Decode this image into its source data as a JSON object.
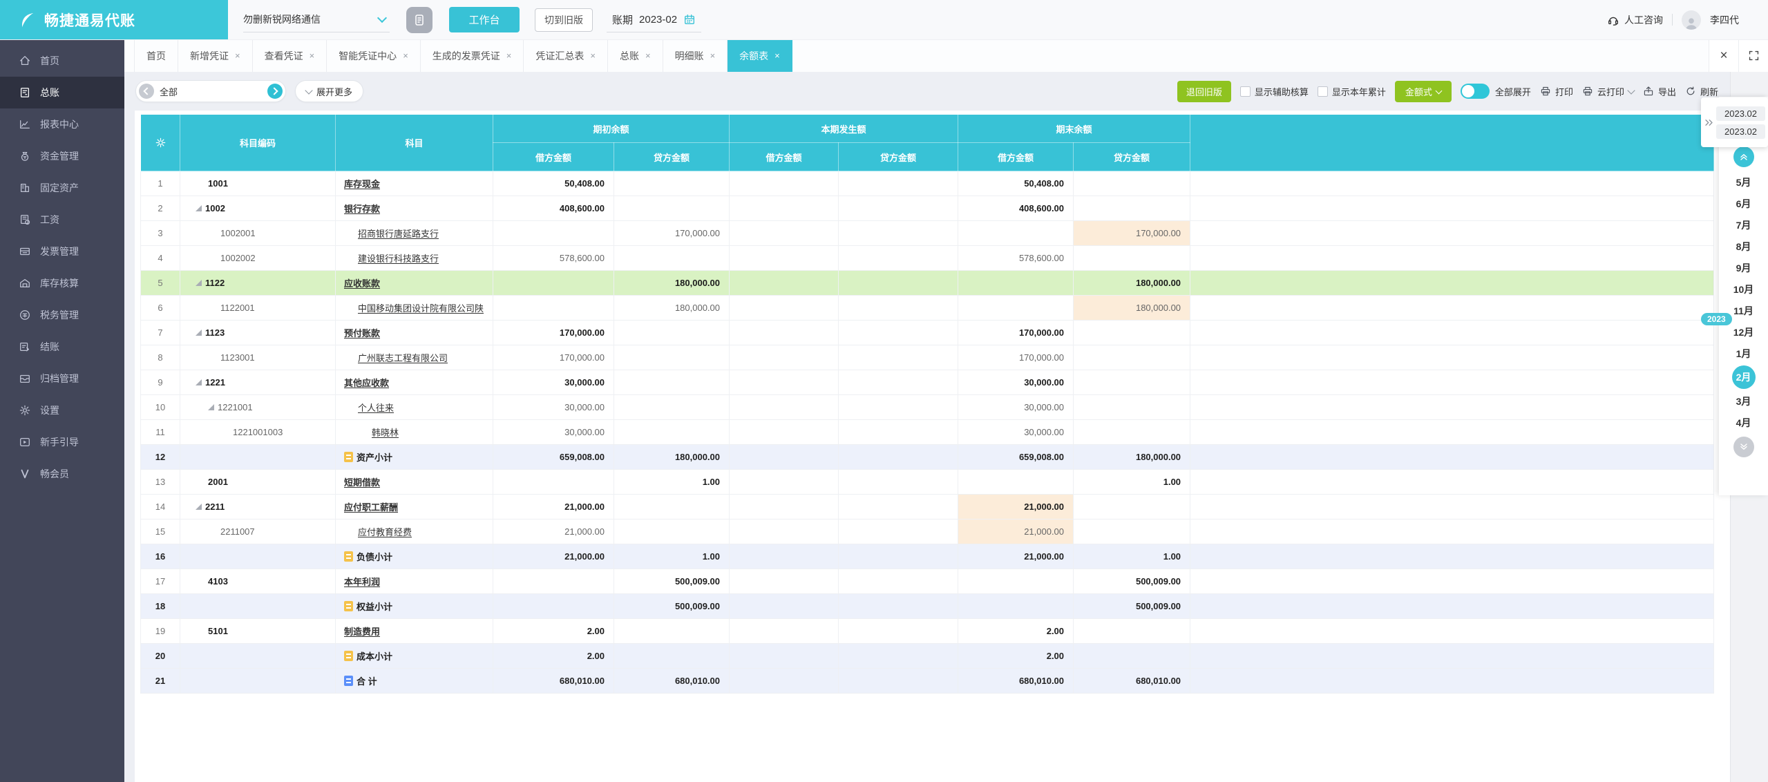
{
  "topbar": {
    "logo": "畅捷通易代账",
    "company": "勿删新锐网络通信",
    "workbench": "工作台",
    "switch_old": "切到旧版",
    "period_label": "账期",
    "period_value": "2023-02",
    "support": "人工咨询",
    "username": "李四代"
  },
  "sidebar": {
    "items": [
      {
        "label": "首页",
        "icon": "home-icon",
        "active": false
      },
      {
        "label": "总账",
        "icon": "ledger-icon",
        "active": true
      },
      {
        "label": "报表中心",
        "icon": "report-icon",
        "active": false
      },
      {
        "label": "资金管理",
        "icon": "fund-icon",
        "active": false
      },
      {
        "label": "固定资产",
        "icon": "asset-icon",
        "active": false
      },
      {
        "label": "工资",
        "icon": "salary-icon",
        "active": false
      },
      {
        "label": "发票管理",
        "icon": "invoice-icon",
        "active": false
      },
      {
        "label": "库存核算",
        "icon": "inventory-icon",
        "active": false
      },
      {
        "label": "税务管理",
        "icon": "tax-icon",
        "active": false
      },
      {
        "label": "结账",
        "icon": "closing-icon",
        "active": false
      },
      {
        "label": "归档管理",
        "icon": "archive-icon",
        "active": false
      },
      {
        "label": "设置",
        "icon": "settings-icon",
        "active": false
      },
      {
        "label": "新手引导",
        "icon": "guide-icon",
        "active": false
      },
      {
        "label": "畅会员",
        "icon": "member-icon",
        "active": false
      }
    ]
  },
  "tabbar": {
    "tabs": [
      {
        "label": "首页",
        "closable": false,
        "active": false
      },
      {
        "label": "新增凭证",
        "closable": true,
        "active": false
      },
      {
        "label": "查看凭证",
        "closable": true,
        "active": false
      },
      {
        "label": "智能凭证中心",
        "closable": true,
        "active": false
      },
      {
        "label": "生成的发票凭证",
        "closable": true,
        "active": false
      },
      {
        "label": "凭证汇总表",
        "closable": true,
        "active": false
      },
      {
        "label": "总账",
        "closable": true,
        "active": false
      },
      {
        "label": "明细账",
        "closable": true,
        "active": false
      },
      {
        "label": "余额表",
        "closable": true,
        "active": true
      }
    ]
  },
  "toolbar": {
    "filter_all": "全部",
    "expand_more": "展开更多",
    "back_old": "退回旧版",
    "show_aux": "显示辅助核算",
    "show_ytd": "显示本年累计",
    "amount_style": "金额式",
    "expand_all": "全部展开",
    "print": "打印",
    "cloud_print": "云打印",
    "export": "导出",
    "refresh": "刷新"
  },
  "table": {
    "group_headers": {
      "code": "科目编码",
      "subject": "科目",
      "opening": "期初余额",
      "current": "本期发生额",
      "ending": "期末余额"
    },
    "sub_headers": {
      "debit": "借方金额",
      "credit": "贷方金额"
    },
    "rows": [
      {
        "num": 1,
        "code": "1001",
        "level": 0,
        "expand": false,
        "bold": true,
        "type": "account",
        "subject": "库存现金",
        "ob_d": "50,408.00",
        "ob_c": "",
        "cp_d": "",
        "cp_c": "",
        "eb_d": "50,408.00",
        "eb_c": "",
        "row_bg": "",
        "icon": "",
        "peach": []
      },
      {
        "num": 2,
        "code": "1002",
        "level": 0,
        "expand": true,
        "bold": true,
        "type": "account",
        "subject": "银行存款",
        "ob_d": "408,600.00",
        "ob_c": "",
        "cp_d": "",
        "cp_c": "",
        "eb_d": "408,600.00",
        "eb_c": "",
        "row_bg": "",
        "icon": "",
        "peach": []
      },
      {
        "num": 3,
        "code": "1002001",
        "level": 1,
        "expand": false,
        "bold": false,
        "type": "account",
        "subject": "招商银行唐延路支行",
        "ob_d": "",
        "ob_c": "170,000.00",
        "cp_d": "",
        "cp_c": "",
        "eb_d": "",
        "eb_c": "170,000.00",
        "row_bg": "",
        "icon": "",
        "peach": [
          "eb_c"
        ]
      },
      {
        "num": 4,
        "code": "1002002",
        "level": 1,
        "expand": false,
        "bold": false,
        "type": "account",
        "subject": "建设银行科技路支行",
        "ob_d": "578,600.00",
        "ob_c": "",
        "cp_d": "",
        "cp_c": "",
        "eb_d": "578,600.00",
        "eb_c": "",
        "row_bg": "",
        "icon": "",
        "peach": []
      },
      {
        "num": 5,
        "code": "1122",
        "level": 0,
        "expand": true,
        "bold": true,
        "type": "account",
        "subject": "应收账款",
        "ob_d": "",
        "ob_c": "180,000.00",
        "cp_d": "",
        "cp_c": "",
        "eb_d": "",
        "eb_c": "180,000.00",
        "row_bg": "green",
        "icon": "",
        "peach": [
          "eb_c"
        ]
      },
      {
        "num": 6,
        "code": "1122001",
        "level": 1,
        "expand": false,
        "bold": false,
        "type": "account",
        "subject": "中国移动集团设计院有限公司陕",
        "ob_d": "",
        "ob_c": "180,000.00",
        "cp_d": "",
        "cp_c": "",
        "eb_d": "",
        "eb_c": "180,000.00",
        "row_bg": "",
        "icon": "",
        "peach": [
          "eb_c"
        ]
      },
      {
        "num": 7,
        "code": "1123",
        "level": 0,
        "expand": true,
        "bold": true,
        "type": "account",
        "subject": "预付账款",
        "ob_d": "170,000.00",
        "ob_c": "",
        "cp_d": "",
        "cp_c": "",
        "eb_d": "170,000.00",
        "eb_c": "",
        "row_bg": "",
        "icon": "",
        "peach": []
      },
      {
        "num": 8,
        "code": "1123001",
        "level": 1,
        "expand": false,
        "bold": false,
        "type": "account",
        "subject": "广州联志工程有限公司",
        "ob_d": "170,000.00",
        "ob_c": "",
        "cp_d": "",
        "cp_c": "",
        "eb_d": "170,000.00",
        "eb_c": "",
        "row_bg": "",
        "icon": "",
        "peach": []
      },
      {
        "num": 9,
        "code": "1221",
        "level": 0,
        "expand": true,
        "bold": true,
        "type": "account",
        "subject": "其他应收款",
        "ob_d": "30,000.00",
        "ob_c": "",
        "cp_d": "",
        "cp_c": "",
        "eb_d": "30,000.00",
        "eb_c": "",
        "row_bg": "",
        "icon": "",
        "peach": []
      },
      {
        "num": 10,
        "code": "1221001",
        "level": 1,
        "expand": true,
        "bold": false,
        "type": "account",
        "subject": "个人往来",
        "ob_d": "30,000.00",
        "ob_c": "",
        "cp_d": "",
        "cp_c": "",
        "eb_d": "30,000.00",
        "eb_c": "",
        "row_bg": "",
        "icon": "",
        "peach": []
      },
      {
        "num": 11,
        "code": "1221001003",
        "level": 2,
        "expand": false,
        "bold": false,
        "type": "account",
        "subject": "韩晓林",
        "ob_d": "30,000.00",
        "ob_c": "",
        "cp_d": "",
        "cp_c": "",
        "eb_d": "30,000.00",
        "eb_c": "",
        "row_bg": "",
        "icon": "",
        "peach": []
      },
      {
        "num": 12,
        "code": "",
        "level": 0,
        "expand": false,
        "bold": true,
        "type": "subtotal",
        "subject": "资产小计",
        "ob_d": "659,008.00",
        "ob_c": "180,000.00",
        "cp_d": "",
        "cp_c": "",
        "eb_d": "659,008.00",
        "eb_c": "180,000.00",
        "row_bg": "blue",
        "icon": "yellow",
        "peach": []
      },
      {
        "num": 13,
        "code": "2001",
        "level": 0,
        "expand": false,
        "bold": true,
        "type": "account",
        "subject": "短期借款",
        "ob_d": "",
        "ob_c": "1.00",
        "cp_d": "",
        "cp_c": "",
        "eb_d": "",
        "eb_c": "1.00",
        "row_bg": "",
        "icon": "",
        "peach": []
      },
      {
        "num": 14,
        "code": "2211",
        "level": 0,
        "expand": true,
        "bold": true,
        "type": "account",
        "subject": "应付职工薪酬",
        "ob_d": "21,000.00",
        "ob_c": "",
        "cp_d": "",
        "cp_c": "",
        "eb_d": "21,000.00",
        "eb_c": "",
        "row_bg": "",
        "icon": "",
        "peach": [
          "eb_d"
        ]
      },
      {
        "num": 15,
        "code": "2211007",
        "level": 1,
        "expand": false,
        "bold": false,
        "type": "account",
        "subject": "应付教育经费",
        "ob_d": "21,000.00",
        "ob_c": "",
        "cp_d": "",
        "cp_c": "",
        "eb_d": "21,000.00",
        "eb_c": "",
        "row_bg": "",
        "icon": "",
        "peach": [
          "eb_d"
        ]
      },
      {
        "num": 16,
        "code": "",
        "level": 0,
        "expand": false,
        "bold": true,
        "type": "subtotal",
        "subject": "负债小计",
        "ob_d": "21,000.00",
        "ob_c": "1.00",
        "cp_d": "",
        "cp_c": "",
        "eb_d": "21,000.00",
        "eb_c": "1.00",
        "row_bg": "blue",
        "icon": "yellow",
        "peach": []
      },
      {
        "num": 17,
        "code": "4103",
        "level": 0,
        "expand": false,
        "bold": true,
        "type": "account",
        "subject": "本年利润",
        "ob_d": "",
        "ob_c": "500,009.00",
        "cp_d": "",
        "cp_c": "",
        "eb_d": "",
        "eb_c": "500,009.00",
        "row_bg": "",
        "icon": "",
        "peach": []
      },
      {
        "num": 18,
        "code": "",
        "level": 0,
        "expand": false,
        "bold": true,
        "type": "subtotal",
        "subject": "权益小计",
        "ob_d": "",
        "ob_c": "500,009.00",
        "cp_d": "",
        "cp_c": "",
        "eb_d": "",
        "eb_c": "500,009.00",
        "row_bg": "blue",
        "icon": "yellow",
        "peach": []
      },
      {
        "num": 19,
        "code": "5101",
        "level": 0,
        "expand": false,
        "bold": true,
        "type": "account",
        "subject": "制造费用",
        "ob_d": "2.00",
        "ob_c": "",
        "cp_d": "",
        "cp_c": "",
        "eb_d": "2.00",
        "eb_c": "",
        "row_bg": "",
        "icon": "",
        "peach": []
      },
      {
        "num": 20,
        "code": "",
        "level": 0,
        "expand": false,
        "bold": true,
        "type": "subtotal",
        "subject": "成本小计",
        "ob_d": "2.00",
        "ob_c": "",
        "cp_d": "",
        "cp_c": "",
        "eb_d": "2.00",
        "eb_c": "",
        "row_bg": "blue",
        "icon": "yellow",
        "peach": []
      },
      {
        "num": 21,
        "code": "",
        "level": 0,
        "expand": false,
        "bold": true,
        "type": "total",
        "subject": "合 计",
        "ob_d": "680,010.00",
        "ob_c": "680,010.00",
        "cp_d": "",
        "cp_c": "",
        "eb_d": "680,010.00",
        "eb_c": "680,010.00",
        "row_bg": "blue",
        "icon": "blue",
        "peach": []
      }
    ]
  },
  "right_rail": {
    "period_from": "2023.02",
    "period_to": "2023.02",
    "year_badge": "2023",
    "months": [
      "5月",
      "6月",
      "7月",
      "8月",
      "9月",
      "10月",
      "11月",
      "12月",
      "1月",
      "2月",
      "3月",
      "4月"
    ],
    "selected_index": 9
  },
  "colors": {
    "accent_teal": "#38c2d6",
    "sidebar_bg": "#424659",
    "sidebar_active_bg": "#2e3140",
    "button_green": "#8fc320",
    "row_green": "#d9f2c3",
    "row_blue": "#edf1fb",
    "cell_peach": "#fcecd9",
    "subtotal_icon_yellow": "#f5c24a",
    "total_icon_blue": "#5b8ff9"
  }
}
